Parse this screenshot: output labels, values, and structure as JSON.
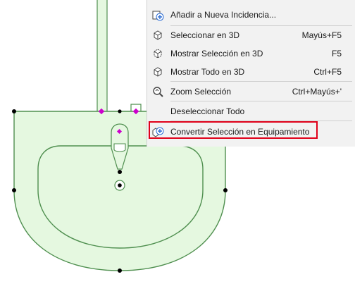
{
  "drawing": {
    "name": "sink-plan-drawing",
    "fill_color": "#e5f8e0",
    "stroke_color": "#4f8f4f",
    "hotspot_color": "#000000",
    "selection_marker_color": "#cc00cc"
  },
  "context_menu": {
    "items": [
      {
        "id": "add-incidence",
        "label": "Añadir a Nueva Incidencia...",
        "shortcut": "",
        "icon": "add-incidence-icon"
      },
      {
        "id": "select-3d",
        "label": "Seleccionar en 3D",
        "shortcut": "Mayús+F5",
        "icon": "select-3d-icon"
      },
      {
        "id": "show-selection-3d",
        "label": "Mostrar Selección en 3D",
        "shortcut": "F5",
        "icon": "show-selection-3d-icon"
      },
      {
        "id": "show-all-3d",
        "label": "Mostrar Todo en 3D",
        "shortcut": "Ctrl+F5",
        "icon": "show-all-3d-icon"
      },
      {
        "id": "zoom-selection",
        "label": "Zoom Selección",
        "shortcut": "Ctrl+Mayús+'",
        "icon": "zoom-selection-icon"
      },
      {
        "id": "deselect-all",
        "label": "Deseleccionar Todo",
        "shortcut": "",
        "icon": ""
      },
      {
        "id": "convert-to-equipment",
        "label": "Convertir Selección en Equipamiento",
        "shortcut": "",
        "icon": "convert-equipment-icon",
        "highlighted": true
      }
    ],
    "background_color": "#f2f2f2",
    "highlight_color": "#e0001a"
  }
}
